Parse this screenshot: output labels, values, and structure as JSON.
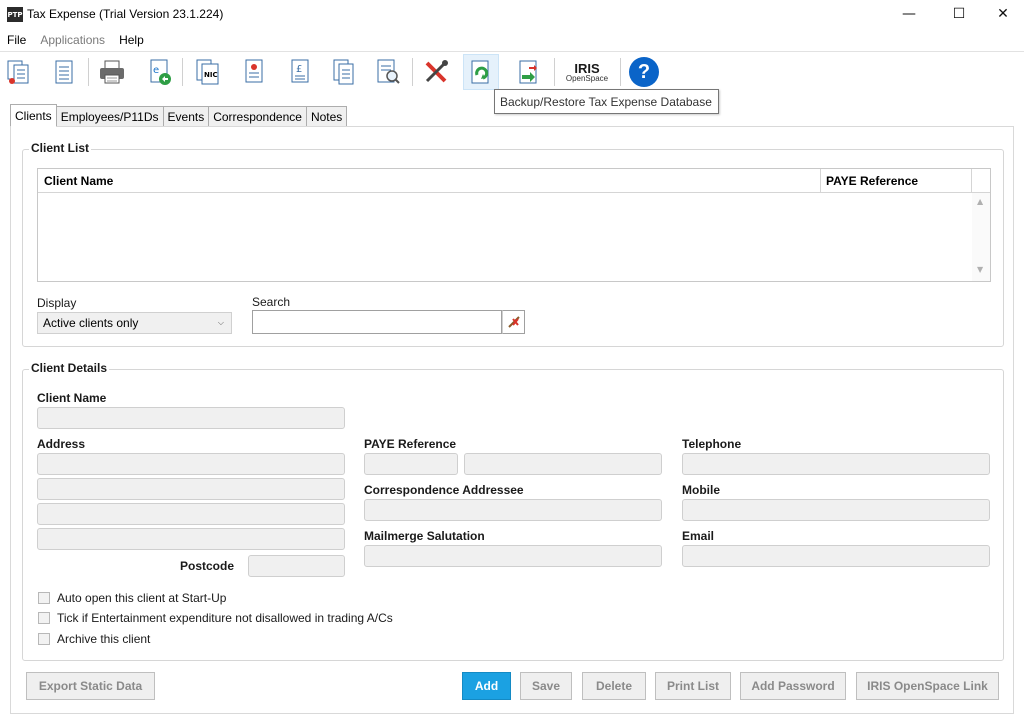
{
  "window": {
    "app_icon_text": "PTP",
    "title": "Tax Expense (Trial Version 23.1.224)",
    "minimize_glyph": "—",
    "maximize_glyph": "☐",
    "close_glyph": "✕"
  },
  "menu": [
    {
      "label": "File",
      "enabled": true
    },
    {
      "label": "Applications",
      "enabled": false
    },
    {
      "label": "Help",
      "enabled": true
    }
  ],
  "toolbar": {
    "buttons": [
      "documents-icon",
      "document-icon",
      "print-icon",
      "internet-document-icon",
      "nic-document-icon",
      "red-document-icon",
      "currency-document-icon",
      "multi-document-icon",
      "search-document-icon",
      "tools-icon",
      "backup-restore-icon",
      "export-icon",
      "iris-openspace-icon",
      "help-icon"
    ],
    "iris_logo": "IRIS",
    "iris_sub": "OpenSpace",
    "help_glyph": "?",
    "tooltip": "Backup/Restore Tax Expense Database"
  },
  "tabs": [
    {
      "label": "Clients",
      "active": true
    },
    {
      "label": "Employees/P11Ds",
      "active": false
    },
    {
      "label": "Events",
      "active": false
    },
    {
      "label": "Correspondence",
      "active": false
    },
    {
      "label": "Notes",
      "active": false
    }
  ],
  "client_list": {
    "title": "Client List",
    "columns": [
      "Client Name",
      "PAYE Reference"
    ],
    "rows": [],
    "display_label": "Display",
    "display_value": "Active clients only",
    "search_label": "Search",
    "search_value": ""
  },
  "client_details": {
    "title": "Client Details",
    "client_name_label": "Client Name",
    "address_label": "Address",
    "postcode_label": "Postcode",
    "paye_label": "PAYE Reference",
    "correspondence_label": "Correspondence Addressee",
    "salutation_label": "Mailmerge Salutation",
    "telephone_label": "Telephone",
    "mobile_label": "Mobile",
    "email_label": "Email",
    "checkboxes": [
      {
        "label": "Auto open this client at Start-Up",
        "checked": false
      },
      {
        "label": "Tick if Entertainment expenditure not disallowed in trading A/Cs",
        "checked": false
      },
      {
        "label": "Archive this client",
        "checked": false
      }
    ]
  },
  "buttons": {
    "export": "Export Static Data",
    "add": "Add",
    "save": "Save",
    "delete": "Delete",
    "print_list": "Print List",
    "add_password": "Add Password",
    "iris_link": "IRIS OpenSpace Link"
  },
  "colors": {
    "accent": "#1ba1e2",
    "disabled_text": "#8a8a8a",
    "field_bg": "#f0f0f0",
    "help_blue": "#0a64c8"
  }
}
